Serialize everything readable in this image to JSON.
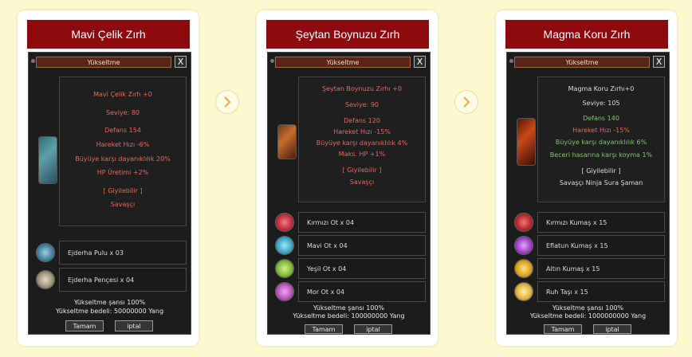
{
  "cards": [
    {
      "title": "Mavi Çelik Zırh",
      "window_title": "Yükseltme",
      "close": "X",
      "info": [
        {
          "text": "Mavi Çelik Zırh +0",
          "color": "red"
        },
        {
          "text": "Seviye: 80",
          "color": "red"
        },
        {
          "text": "Defans 154",
          "color": "red"
        },
        {
          "text": "Hareket Hızı -6%",
          "color": "red"
        },
        {
          "text": "Büyüye karşı dayanıklılık 20%",
          "color": "red"
        },
        {
          "text": "HP Üretimi +2%",
          "color": "red"
        },
        {
          "text": "[ Giyilebilir ]",
          "color": "red"
        },
        {
          "text": "Savaşçı",
          "color": "red"
        }
      ],
      "materials": [
        {
          "label": "Ejderha Pulu x 03",
          "icon": "dragon-scale-icon",
          "color": "#3d7f9a"
        },
        {
          "label": "Ejderha Pençesi x 04",
          "icon": "dragon-claw-icon",
          "color": "#9a8f78"
        }
      ],
      "chance": "Yükseltme şansı 100%",
      "cost": "Yükseltme bedeli: 50000000 Yang",
      "ok": "Tamam",
      "cancel": "iptal"
    },
    {
      "title": "Şeytan Boynuzu Zırh",
      "window_title": "Yükseltme",
      "close": "X",
      "info": [
        {
          "text": "Şeytan Boynuzu Zırhı +0",
          "color": "red"
        },
        {
          "text": "Seviye: 90",
          "color": "red"
        },
        {
          "text": "Defans 120",
          "color": "red"
        },
        {
          "text": "Hareket Hızı -15%",
          "color": "red"
        },
        {
          "text": "Büyüye karşı dayanıklılık 4%",
          "color": "red"
        },
        {
          "text": "Maks. HP +1%",
          "color": "red"
        },
        {
          "text": "[ Giyilebilir ]",
          "color": "red"
        },
        {
          "text": "Savaşçı",
          "color": "red"
        }
      ],
      "materials": [
        {
          "label": "Kırmızı Ot x 04",
          "icon": "red-herb-icon",
          "color": "#c2283c"
        },
        {
          "label": "Mavi Ot x 04",
          "icon": "blue-herb-icon",
          "color": "#3aa3c4"
        },
        {
          "label": "Yeşil Ot x 04",
          "icon": "green-herb-icon",
          "color": "#79b834"
        },
        {
          "label": "Mor Ot x 04",
          "icon": "purple-herb-icon",
          "color": "#b552b8"
        }
      ],
      "chance": "Yükseltme şansı 100%",
      "cost": "Yükseltme bedeli: 100000000 Yang",
      "ok": "Tamam",
      "cancel": "iptal"
    },
    {
      "title": "Magma Koru Zırh",
      "window_title": "Yükseltme",
      "close": "X",
      "info": [
        {
          "text": "Magma Koru Zırhı+0",
          "color": "light"
        },
        {
          "text": "Seviye: 105",
          "color": "light"
        },
        {
          "text": "Defans 140",
          "color": "green"
        },
        {
          "text": "Hareket Hızı -15%",
          "color": "red"
        },
        {
          "text": "Büyüye karşı dayanıklılık 6%",
          "color": "green"
        },
        {
          "text": "Beceri hasarına karşı koyma 1%",
          "color": "green"
        },
        {
          "text": "[ Giyilebilir ]",
          "color": "light"
        },
        {
          "text": "Savaşçı Ninja Sura Şaman",
          "color": "light"
        }
      ],
      "materials": [
        {
          "label": "Kırmızı Kumaş x 15",
          "icon": "red-fabric-icon",
          "color": "#b3242c"
        },
        {
          "label": "Eflatun Kumaş x 15",
          "icon": "violet-fabric-icon",
          "color": "#9a3cc4"
        },
        {
          "label": "Altın Kumaş x 15",
          "icon": "gold-fabric-icon",
          "color": "#d8a11e"
        },
        {
          "label": "Ruh Taşı x 15",
          "icon": "soul-stone-icon",
          "color": "#e0b03a"
        }
      ],
      "chance": "Yükseltme şansı 100%",
      "cost": "Yükseltme bedeli: 1000000000 Yang",
      "ok": "Tamam",
      "cancel": "iptal"
    }
  ]
}
